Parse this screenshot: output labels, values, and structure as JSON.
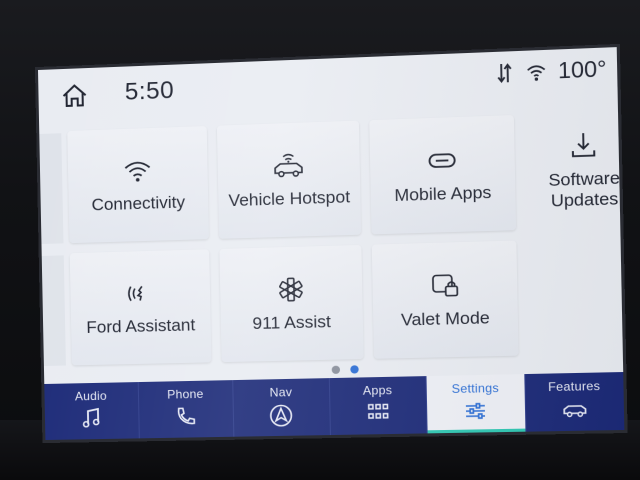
{
  "status": {
    "time": "5:50",
    "temperature": "100°"
  },
  "tiles": [
    {
      "id": "connectivity",
      "label": "Connectivity",
      "icon": "wifi-icon"
    },
    {
      "id": "vehicle-hotspot",
      "label": "Vehicle Hotspot",
      "icon": "car-wifi-icon"
    },
    {
      "id": "mobile-apps",
      "label": "Mobile Apps",
      "icon": "link-icon"
    },
    {
      "id": "software-updates",
      "label": "Software\nUpdates",
      "icon": "download-icon"
    },
    {
      "id": "ford-assistant",
      "label": "Ford Assistant",
      "icon": "voice-assistant-icon"
    },
    {
      "id": "911-assist",
      "label": "911 Assist",
      "icon": "star-of-life-icon"
    },
    {
      "id": "valet-mode",
      "label": "Valet Mode",
      "icon": "valet-lock-icon"
    }
  ],
  "pager": {
    "pages": 2,
    "current": 2
  },
  "nav": [
    {
      "label": "Audio",
      "icon": "music-note-icon",
      "active": false
    },
    {
      "label": "Phone",
      "icon": "phone-icon",
      "active": false
    },
    {
      "label": "Nav",
      "icon": "navigation-arrow-icon",
      "active": false
    },
    {
      "label": "Apps",
      "icon": "apps-grid-icon",
      "active": false
    },
    {
      "label": "Settings",
      "icon": "sliders-icon",
      "active": true
    },
    {
      "label": "Features",
      "icon": "vehicle-icon",
      "active": false
    }
  ],
  "colors": {
    "screen_bg": "#e9ecf2",
    "nav_bg": "#1c2a78",
    "accent": "#2d6fd6",
    "active_underline": "#2fc7b3"
  }
}
